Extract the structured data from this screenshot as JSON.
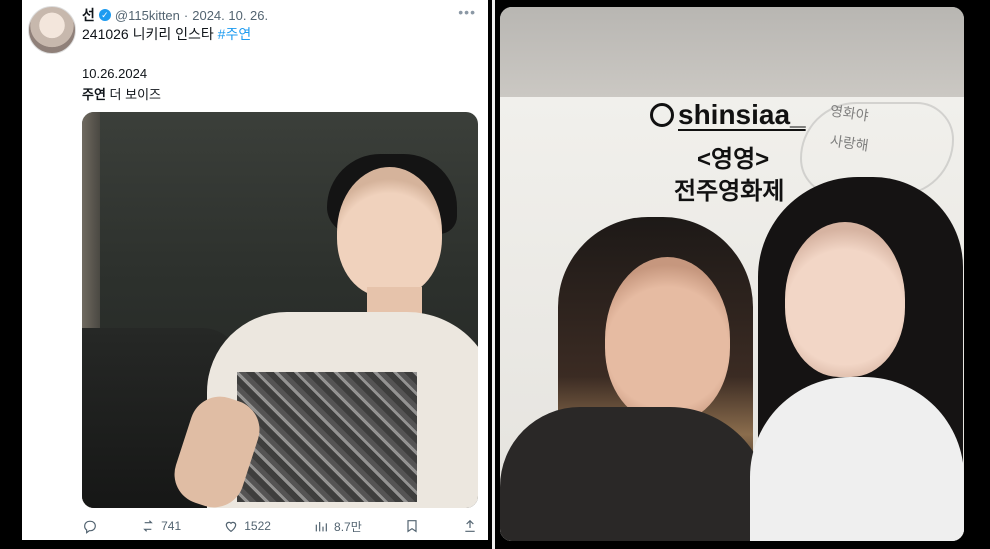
{
  "tweet": {
    "display_name": "선",
    "handle": "@115kitten",
    "separator": "·",
    "date": "2024. 10. 26.",
    "more_label": "•••",
    "text_prefix": "241026 니키리 인스타",
    "hashtag": "#주연",
    "photo_date": "10.26.2024",
    "caption_name": "주연",
    "caption_group": "더 보이즈",
    "stats": {
      "retweets": "741",
      "likes": "1522",
      "views": "8.7만"
    }
  },
  "story": {
    "mention": "shinsiaa_",
    "line2": "<영영>",
    "line3": "전주영화제",
    "wall_text_1": "영화야",
    "wall_text_2": "사랑해"
  }
}
